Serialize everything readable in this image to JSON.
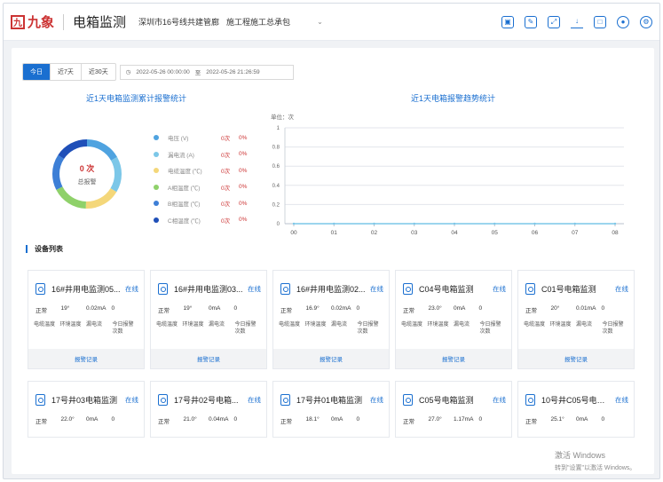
{
  "header": {
    "logo_mark": "九",
    "logo_text": "九象",
    "title": "电箱监测",
    "project_name": "深圳市16号线共建管廊",
    "project_sub": "施工程施工总承包"
  },
  "toolbar_icons": [
    "monitor-icon",
    "edit-icon",
    "fullscreen-icon",
    "download-icon",
    "box-icon",
    "user-icon",
    "settings-icon"
  ],
  "filters": {
    "tabs": [
      "今日",
      "近7天",
      "近30天"
    ],
    "active_tab": 0,
    "date_start": "2022-05-26 00:00:00",
    "date_sep": "至",
    "date_end": "2022-05-26 21:26:59"
  },
  "left_chart": {
    "title": "近1天电箱监测累计报警统计",
    "total": "0 次",
    "total_label": "总报警",
    "legend": [
      {
        "name": "电压 (V)",
        "count": "0次",
        "pct": "0%",
        "color": "#4fa3e0"
      },
      {
        "name": "漏电流 (A)",
        "count": "0次",
        "pct": "0%",
        "color": "#7cc7e8"
      },
      {
        "name": "电缆温度 (℃)",
        "count": "0次",
        "pct": "0%",
        "color": "#f4d77a"
      },
      {
        "name": "A相温度 (℃)",
        "count": "0次",
        "pct": "0%",
        "color": "#8fd16a"
      },
      {
        "name": "B相温度 (℃)",
        "count": "0次",
        "pct": "0%",
        "color": "#3d7fd6"
      },
      {
        "name": "C相温度 (℃)",
        "count": "0次",
        "pct": "0%",
        "color": "#1f4fb8"
      }
    ]
  },
  "chart_data": {
    "type": "line",
    "title": "近1天电箱报警趋势统计",
    "ylabel": "单位：次",
    "x": [
      "00",
      "01",
      "02",
      "03",
      "04",
      "05",
      "06",
      "07",
      "08"
    ],
    "ylim": [
      0,
      1
    ],
    "yticks": [
      "0",
      "0.2",
      "0.4",
      "0.6",
      "0.8",
      "1"
    ],
    "series": [
      {
        "values": [
          0,
          0,
          0,
          0,
          0,
          0,
          0,
          0,
          0
        ],
        "color": "#7cc7e8"
      }
    ],
    "grid": true
  },
  "device_section": {
    "title": "设备列表",
    "value_labels": [
      "电缆温度",
      "环境温度",
      "漏电流",
      "今日报警次数"
    ],
    "footer_label": "报警记录",
    "row1": [
      {
        "name": "16#井用电监测05...",
        "status": "在线",
        "vals": [
          "正常",
          "19°",
          "0.02mA",
          "0"
        ]
      },
      {
        "name": "16#井用电监测03...",
        "status": "在线",
        "vals": [
          "正常",
          "19°",
          "0mA",
          "0"
        ]
      },
      {
        "name": "16#井用电监测02...",
        "status": "在线",
        "vals": [
          "正常",
          "16.9°",
          "0.02mA",
          "0"
        ]
      },
      {
        "name": "C04号电箱监测",
        "status": "在线",
        "vals": [
          "正常",
          "23.0°",
          "0mA",
          "0"
        ]
      },
      {
        "name": "C01号电箱监测",
        "status": "在线",
        "vals": [
          "正常",
          "20°",
          "0.01mA",
          "0"
        ]
      }
    ],
    "row2": [
      {
        "name": "17号井03电箱监测",
        "status": "在线",
        "vals": [
          "正常",
          "22.0°",
          "0mA",
          "0"
        ]
      },
      {
        "name": "17号井02号电箱...",
        "status": "在线",
        "vals": [
          "正常",
          "21.0°",
          "0.04mA",
          "0"
        ]
      },
      {
        "name": "17号井01电箱监测",
        "status": "在线",
        "vals": [
          "正常",
          "18.1°",
          "0mA",
          "0"
        ]
      },
      {
        "name": "C05号电箱监测",
        "status": "在线",
        "vals": [
          "正常",
          "27.0°",
          "1.17mA",
          "0"
        ]
      },
      {
        "name": "10号井C05号电箱...",
        "status": "在线",
        "vals": [
          "正常",
          "25.1°",
          "0mA",
          "0"
        ]
      }
    ]
  },
  "watermark": {
    "line1": "激活 Windows",
    "line2": "转到\"设置\"以激活 Windows。"
  }
}
